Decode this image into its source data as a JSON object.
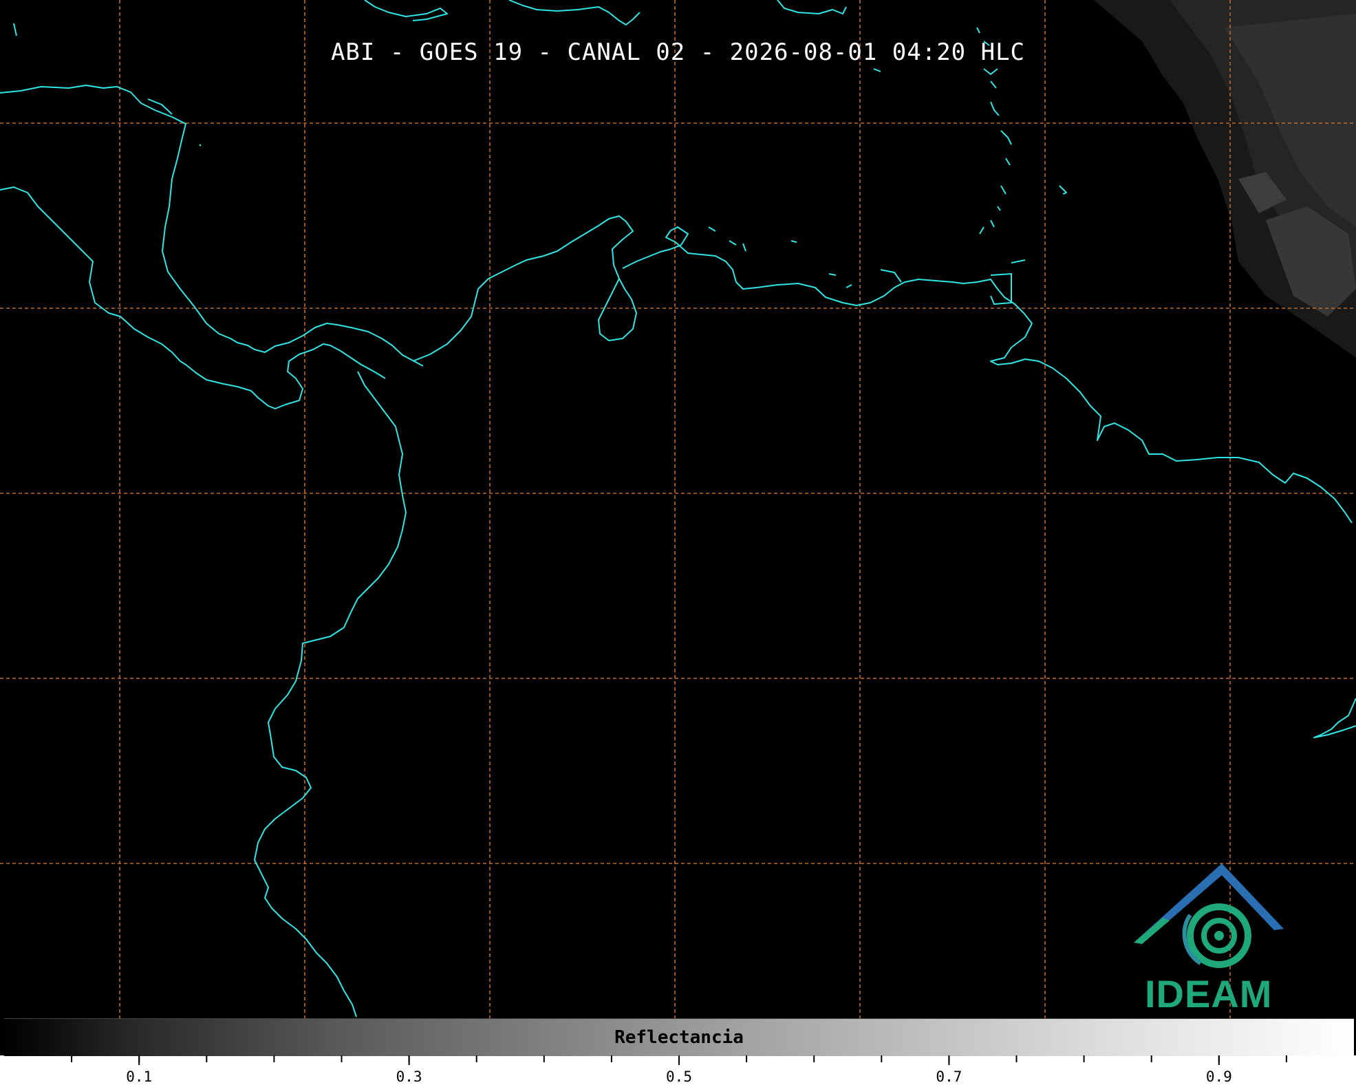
{
  "title": "ABI - GOES 19 - CANAL 02 - 2026-08-01 04:20 HLC",
  "colorbar": {
    "label": "Reflectancia",
    "range": [
      0.0,
      1.0
    ],
    "tick_labels": [
      "0.1",
      "0.3",
      "0.5",
      "0.7",
      "0.9"
    ],
    "tick_values": [
      0.1,
      0.3,
      0.5,
      0.7,
      0.9
    ],
    "minor_tick_step": 0.05
  },
  "logo": {
    "text": "IDEAM"
  },
  "colors": {
    "coastline": "#2ee6e6",
    "graticule": "#c06a2a",
    "background": "#000000",
    "logo_blue": "#2b6fb3",
    "logo_green": "#1fa87a"
  }
}
